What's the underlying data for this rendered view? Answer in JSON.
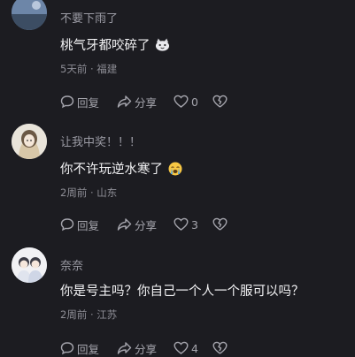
{
  "comments": [
    {
      "username": "不要下雨了",
      "text": "桃气牙都咬碎了",
      "emoji_icon": "cat-face-icon",
      "time": "5天前",
      "location": "福建",
      "actions": {
        "reply": "回复",
        "share": "分享",
        "like_count": "0"
      }
    },
    {
      "username": "让我中奖！！！",
      "text": "你不许玩逆水寒了",
      "emoji_icon": "crying-face-icon",
      "time": "2周前",
      "location": "山东",
      "actions": {
        "reply": "回复",
        "share": "分享",
        "like_count": "3"
      }
    },
    {
      "username": "奈奈",
      "text": "你是号主吗？你自己一个人一个服可以吗？",
      "time": "2周前",
      "location": "江苏",
      "actions": {
        "reply": "回复",
        "share": "分享",
        "like_count": "4"
      }
    }
  ],
  "meta_separator": "·"
}
